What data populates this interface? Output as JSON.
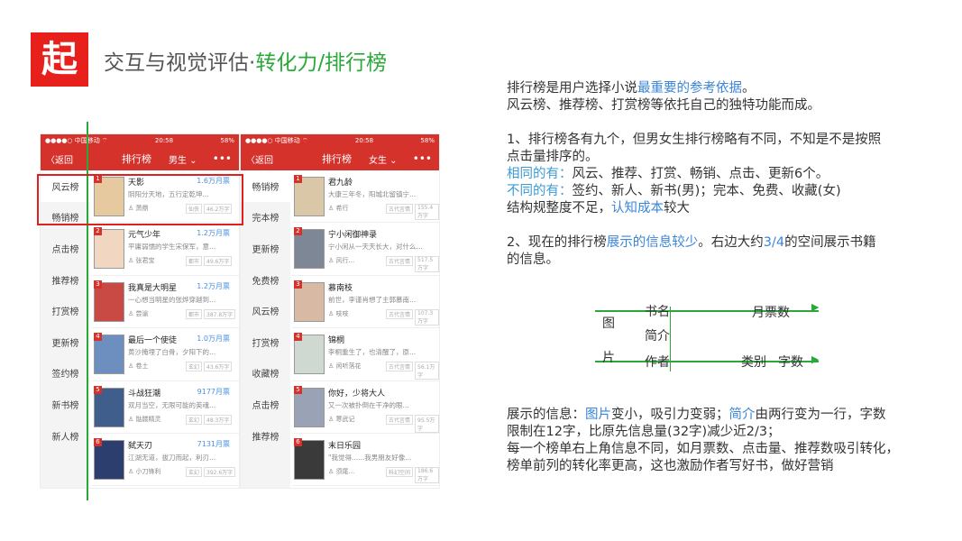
{
  "logo_text": "起",
  "header": {
    "title_plain": "交互与视觉评估·",
    "title_highlight": "转化力/排行榜"
  },
  "phone1": {
    "status": {
      "carrier": "●●●●○ 中国移动 ⌔",
      "time": "20:58",
      "battery": "58%"
    },
    "nav": {
      "back": "〈返回",
      "title": "排行榜",
      "gender": "男生 ⌄",
      "more": "•••"
    },
    "side": [
      "风云榜",
      "畅销榜",
      "点击榜",
      "推荐榜",
      "打赏榜",
      "更新榜",
      "签约榜",
      "新书榜",
      "新人榜"
    ],
    "books": [
      {
        "rank": "1",
        "title": "天影",
        "tickets": "1.6万月票",
        "desc": "阴阳分天地，五行定乾坤...",
        "author": "萧鼎",
        "tag": "仙侠",
        "count": "46.2万字",
        "color": "#e7c9a0"
      },
      {
        "rank": "2",
        "title": "元气少年",
        "tickets": "1.2万月票",
        "desc": "平庸弱懦的学生宋保军，意...",
        "author": "张君宝",
        "tag": "都市",
        "count": "49.6万字",
        "color": "#f1d6c2"
      },
      {
        "rank": "3",
        "title": "我真是大明星",
        "tickets": "1.2万月票",
        "desc": "一心想当明星的张烨穿越到...",
        "author": "尝谕",
        "tag": "都市",
        "count": "387.8万字",
        "color": "#c94a45"
      },
      {
        "rank": "4",
        "title": "最后一个使徒",
        "tickets": "1.0万月票",
        "desc": "黄沙掩埋了白骨，夕阳下的...",
        "author": "卷土",
        "tag": "玄幻",
        "count": "43.6万字",
        "color": "#6d8fbf"
      },
      {
        "rank": "5",
        "title": "斗战狂潮",
        "tickets": "9177月票",
        "desc": "双月当空，无限可能的英魂...",
        "author": "骷髅精灵",
        "tag": "玄幻",
        "count": "48.3万字",
        "color": "#3f5e8c"
      },
      {
        "rank": "6",
        "title": "弑天刃",
        "tickets": "7131月票",
        "desc": "江湖无道，拔刀而起，利刃...",
        "author": "小刀锋利",
        "tag": "玄幻",
        "count": "392.6万字",
        "color": "#2b3e6e"
      }
    ]
  },
  "phone2": {
    "status": {
      "carrier": "●●●●○ 中国移动 ⌔",
      "time": "20:58",
      "battery": "58%"
    },
    "nav": {
      "back": "〈返回",
      "title": "排行榜",
      "gender": "女生 ⌄",
      "more": "•••"
    },
    "side": [
      "畅销榜",
      "完本榜",
      "更新榜",
      "免费榜",
      "风云榜",
      "打赏榜",
      "收藏榜",
      "点击榜",
      "推荐榜"
    ],
    "books": [
      {
        "rank": "1",
        "title": "君九龄",
        "desc": "大康三年冬，阳城北留镇宁...",
        "author": "希行",
        "tag": "古代言情",
        "count": "155.4万字",
        "color": "#d9c7a8"
      },
      {
        "rank": "2",
        "title": "宁小闲御神录",
        "desc": "宁小闲从一天天长大，对什么...",
        "author": "风行...",
        "tag": "古代言情",
        "count": "517.5万字",
        "color": "#7d8796"
      },
      {
        "rank": "3",
        "title": "慕南枝",
        "desc": "前世，李谨肖想了主郭慕南...",
        "author": "吱吱",
        "tag": "古代言情",
        "count": "107.3万字",
        "color": "#d8b9a4"
      },
      {
        "rank": "4",
        "title": "锦桐",
        "desc": "李桐重生了，也清醒了，原...",
        "author": "闲听落花",
        "tag": "古代言情",
        "count": "56.1万字",
        "color": "#cfd9d2"
      },
      {
        "rank": "5",
        "title": "你好，少将大人",
        "desc": "又一次被扑倒在干净的眼...",
        "author": "寒武记",
        "tag": "古代言情",
        "count": "95.5万字",
        "color": "#9aa3b5"
      },
      {
        "rank": "6",
        "title": "末日乐园",
        "desc": "\"我觉得......我男朋友好像...",
        "author": "须尾...",
        "tag": "科幻空间",
        "count": "186.6万字",
        "color": "#3a3a3a"
      }
    ]
  },
  "notes": {
    "p1_l1_a": "排行榜是用户选择小说",
    "p1_l1_b": "最重要的参考依据",
    "p1_l1_c": "。",
    "p1_l2": "风云榜、推荐榜、打赏榜等依托自己的独特功能而成。",
    "p2_l1": "1、排行榜各有九个，但男女生排行榜略有不同，不知是不是按照",
    "p2_l2": "点击量排序的。",
    "p2_l3_a": "相同的有：",
    "p2_l3_b": "风云、推荐、打赏、畅销、点击、更新6个。",
    "p2_l4_a": "不同的有：",
    "p2_l4_b": "签约、新人、新书(男)；完本、免费、收藏(女)",
    "p2_l5_a": "结构规整度不足，",
    "p2_l5_b": "认知成本",
    "p2_l5_c": "较大",
    "p3_l1_a": "2、现在的排行榜",
    "p3_l1_b": "展示的信息较少",
    "p3_l1_c": "。右边大约",
    "p3_l1_d": "3/4",
    "p3_l1_e": "的空间展示书籍",
    "p3_l2": "的信息。",
    "p4_l1_a": "展示的信息：",
    "p4_l1_b": "图片",
    "p4_l1_c": "变小，吸引力变弱；",
    "p4_l1_d": "简介",
    "p4_l1_e": "由两行变为一行，字数",
    "p4_l2": "限制在12字，比原先信息量(32字)减少近2/3；",
    "p4_l3": "每一个榜单右上角信息不同，如月票数、点击量、推荐数吸引转化，",
    "p4_l4": "榜单前列的转化率更高，这也激励作者写好书，做好营销"
  },
  "diagram": {
    "pic1": "图",
    "pic2": "片",
    "name": "书名",
    "tickets": "月票数",
    "intro": "简介",
    "author": "作者",
    "category": "类别",
    "words": "字数"
  }
}
